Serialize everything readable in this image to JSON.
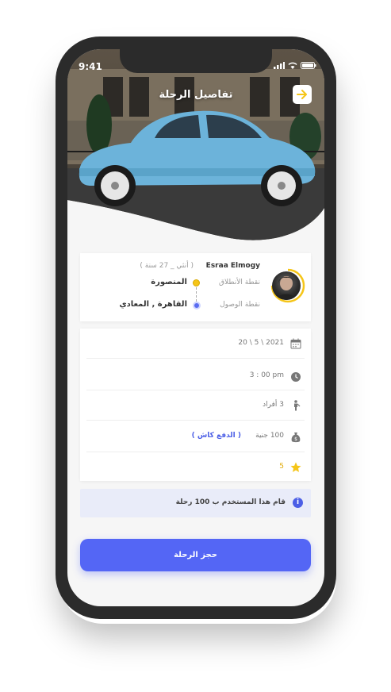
{
  "status_bar": {
    "time": "9:41"
  },
  "header": {
    "title": "تفاصيل الرحلة",
    "back_icon": "arrow-right-icon"
  },
  "driver": {
    "name": "Esraa Elmogy",
    "age_gender": "( أنثي _ 27 سنة )",
    "from_label": "نقطة الأنطلاق",
    "from_value": "المنصورة",
    "to_label": "نقطة الوصول",
    "to_value": "القاهرة , المعادي"
  },
  "details": {
    "date": "20 \\ 5 \\ 2021",
    "time": "3 : 00 pm",
    "persons": "3 أفراد",
    "price": "100 جنية",
    "payment": "( الدفع كاش )",
    "rating": "5"
  },
  "info": {
    "text": "قام هذا المستخدم ب 100 رحلة",
    "icon": "i"
  },
  "actions": {
    "book_label": "حجز الرحلة"
  },
  "colors": {
    "accent": "#5466f5",
    "star": "#f5c518",
    "info_bg": "#e9ecf9"
  }
}
